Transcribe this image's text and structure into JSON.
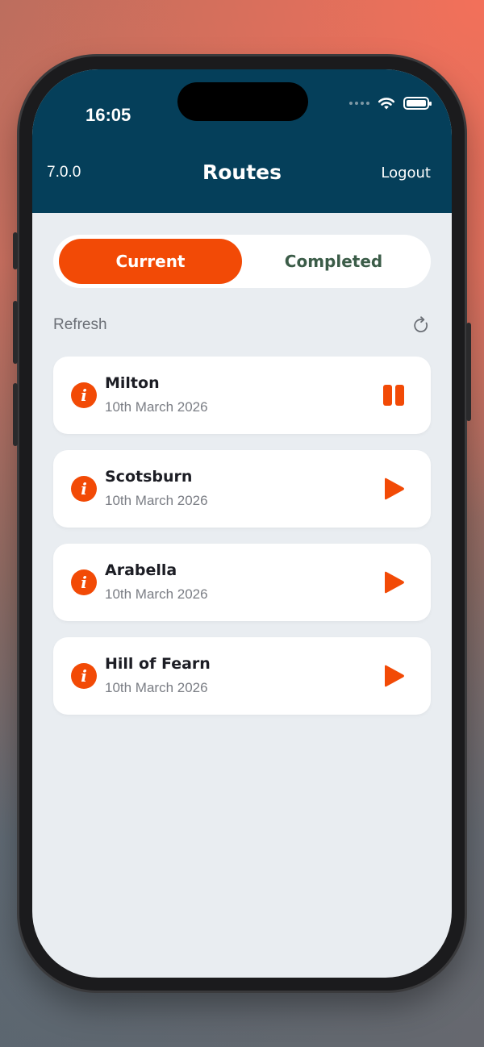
{
  "status_bar": {
    "time": "16:05"
  },
  "header": {
    "version": "7.0.0",
    "title": "Routes",
    "logout_label": "Logout"
  },
  "tabs": [
    {
      "label": "Current",
      "selected": true
    },
    {
      "label": "Completed",
      "selected": false
    }
  ],
  "refresh": {
    "label": "Refresh"
  },
  "routes": [
    {
      "name": "Milton",
      "date": "10th March 2026",
      "action": "pause-icon"
    },
    {
      "name": "Scotsburn",
      "date": "10th March 2026",
      "action": "play-icon"
    },
    {
      "name": "Arabella",
      "date": "10th March 2026",
      "action": "play-icon"
    },
    {
      "name": "Hill of Fearn",
      "date": "10th March 2026",
      "action": "play-icon"
    }
  ],
  "colors": {
    "header_bg": "#053f5a",
    "accent": "#f24a06",
    "screen_bg": "#e9edf1",
    "completed_text": "#3b5c48"
  }
}
